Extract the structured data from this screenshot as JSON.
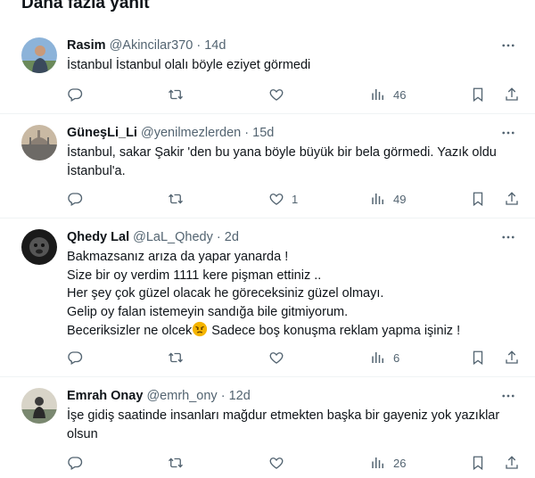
{
  "section": {
    "title": "Daha fazla yanıt"
  },
  "tweets": [
    {
      "name": "Rasim",
      "handle": "@Akincilar370",
      "time": "14d",
      "lines": [
        "İstanbul İstanbul olalı böyle eziyet görmedi"
      ],
      "likes": "",
      "views": "46"
    },
    {
      "name": "GüneşLi_Li",
      "handle": "@yenilmezlerden",
      "time": "15d",
      "lines": [
        "İstanbul, sakar Şakir 'den bu yana böyle büyük bir bela görmedi. Yazık oldu",
        "İstanbul'a."
      ],
      "likes": "1",
      "views": "49"
    },
    {
      "name": "Qhedy Lal",
      "handle": "@LaL_Qhedy",
      "time": "2d",
      "lines": [
        "Bakmazsanız arıza da yapar yanarda !",
        "Size bir oy verdim 1111 kere pişman ettiniz ..",
        "Her şey çok güzel olacak he göreceksiniz güzel olmayı.",
        "Gelip oy falan istemeyin sandığa bile gitmiyorum."
      ],
      "line5a": "Beceriksizler ne olcek",
      "line5b": " Sadece boş konuşma reklam yapma işiniz !",
      "likes": "",
      "views": "6"
    },
    {
      "name": "Emrah Onay",
      "handle": "@emrh_ony",
      "time": "12d",
      "lines": [
        "İşe gidiş saatinde insanları mağdur etmekten başka bir gayeniz yok yazıklar",
        "olsun"
      ],
      "likes": "",
      "views": "26"
    }
  ],
  "dot": "·",
  "icons": {
    "reply": "reply-icon",
    "retweet": "retweet-icon",
    "like": "heart-icon",
    "views": "views-icon",
    "bookmark": "bookmark-icon",
    "share": "share-icon",
    "more": "more-icon",
    "emoji": "angry-face-emoji"
  },
  "colors": {
    "text": "#0f1419",
    "muted": "#536471",
    "divider": "#eff3f4"
  }
}
